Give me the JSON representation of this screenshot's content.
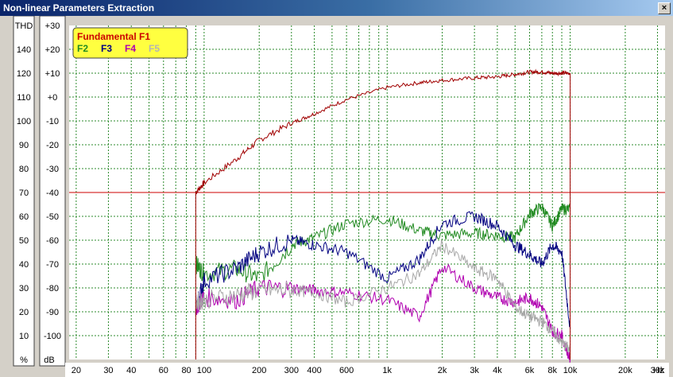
{
  "window": {
    "title": "Non-linear Parameters Extraction",
    "close_glyph": "×"
  },
  "colors": {
    "bg": "#d4d0c8",
    "plot_bg": "#ffffff",
    "grid": "#2e8b2e",
    "f1": "#a00000",
    "f2": "#228b22",
    "f3": "#000080",
    "f4": "#b000b0",
    "f5": "#a8a8a8",
    "threshold": "#cc0000"
  },
  "legend": {
    "items": [
      {
        "label": "Fundamental F1",
        "color": "#cc0000"
      },
      {
        "label": "F2",
        "color": "#228b22"
      },
      {
        "label": "F3",
        "color": "#000080"
      },
      {
        "label": "F4",
        "color": "#b000b0"
      },
      {
        "label": "F5",
        "color": "#b4b4b4"
      }
    ]
  },
  "chart_data": {
    "type": "line",
    "xscale": "log",
    "xlim": [
      20,
      20000
    ],
    "ylim": [
      -110,
      30
    ],
    "xunit": "Hz",
    "ylabel_left": "THD",
    "ylabel_left_unit": "%",
    "ylabel_right": "dB",
    "x_ticks": [
      {
        "v": 20,
        "t": "20"
      },
      {
        "v": 30,
        "t": "30"
      },
      {
        "v": 40,
        "t": "40"
      },
      {
        "v": 60,
        "t": "60"
      },
      {
        "v": 80,
        "t": "80"
      },
      {
        "v": 100,
        "t": "100"
      },
      {
        "v": 200,
        "t": "200"
      },
      {
        "v": 300,
        "t": "300"
      },
      {
        "v": 400,
        "t": "400"
      },
      {
        "v": 600,
        "t": "600"
      },
      {
        "v": 1000,
        "t": "1k"
      },
      {
        "v": 2000,
        "t": "2k"
      },
      {
        "v": 3000,
        "t": "3k"
      },
      {
        "v": 4000,
        "t": "4k"
      },
      {
        "v": 6000,
        "t": "6k"
      },
      {
        "v": 8000,
        "t": "8k"
      },
      {
        "v": 10000,
        "t": "10k"
      },
      {
        "v": 20000,
        "t": "20k"
      },
      {
        "v": 30000,
        "t": "30k"
      }
    ],
    "thd_ticks": [
      "140",
      "120",
      "110",
      "100",
      "90",
      "80",
      "70",
      "60",
      "50",
      "40",
      "30",
      "20",
      "10"
    ],
    "db_ticks": [
      "+30",
      "+20",
      "+10",
      "+0",
      "-10",
      "-20",
      "-30",
      "-40",
      "-50",
      "-60",
      "-70",
      "-80",
      "-90",
      "-100"
    ],
    "threshold_db": -40,
    "series": [
      {
        "name": "Fundamental F1",
        "color": "#a00000",
        "x": [
          90,
          100,
          150,
          200,
          300,
          400,
          600,
          1000,
          1500,
          2000,
          3000,
          4000,
          5000,
          6000,
          7000,
          8000,
          9000,
          10000
        ],
        "y": [
          -40,
          -36,
          -26,
          -18,
          -11,
          -7,
          -1,
          4,
          6,
          7,
          8,
          8.5,
          9.5,
          10.5,
          10.5,
          10,
          10,
          10
        ]
      },
      {
        "name": "F2",
        "color": "#228b22",
        "x": [
          90,
          100,
          150,
          200,
          300,
          400,
          600,
          1000,
          1500,
          2000,
          3000,
          4000,
          5000,
          6000,
          7000,
          8000,
          9000,
          10000
        ],
        "y": [
          -70,
          -74,
          -72,
          -76,
          -62,
          -59,
          -53,
          -51,
          -56,
          -58,
          -57,
          -58,
          -59,
          -49,
          -46,
          -54,
          -47,
          -47
        ]
      },
      {
        "name": "F3",
        "color": "#000080",
        "x": [
          90,
          100,
          150,
          200,
          300,
          400,
          600,
          1000,
          1500,
          2000,
          3000,
          4000,
          5000,
          6000,
          7000,
          8000,
          9000,
          10000
        ],
        "y": [
          -88,
          -77,
          -72,
          -65,
          -60,
          -62,
          -65,
          -76,
          -68,
          -53,
          -50,
          -54,
          -62,
          -66,
          -70,
          -62,
          -65,
          -97
        ]
      },
      {
        "name": "F4",
        "color": "#b000b0",
        "x": [
          90,
          100,
          150,
          200,
          300,
          400,
          600,
          1000,
          1500,
          2000,
          3000,
          4000,
          5000,
          6000,
          7000,
          8000,
          9000,
          10000
        ],
        "y": [
          -88,
          -84,
          -85,
          -80,
          -80,
          -81,
          -82,
          -85,
          -92,
          -71,
          -80,
          -84,
          -86,
          -84,
          -88,
          -98,
          -100,
          -110
        ]
      },
      {
        "name": "F5",
        "color": "#a8a8a8",
        "x": [
          90,
          100,
          150,
          200,
          300,
          400,
          600,
          1000,
          1500,
          2000,
          3000,
          4000,
          5000,
          6000,
          7000,
          8000,
          9000,
          10000
        ],
        "y": [
          -86,
          -85,
          -83,
          -81,
          -81,
          -82,
          -86,
          -80,
          -74,
          -62,
          -72,
          -76,
          -88,
          -92,
          -94,
          -98,
          -103,
          -106
        ]
      }
    ]
  }
}
